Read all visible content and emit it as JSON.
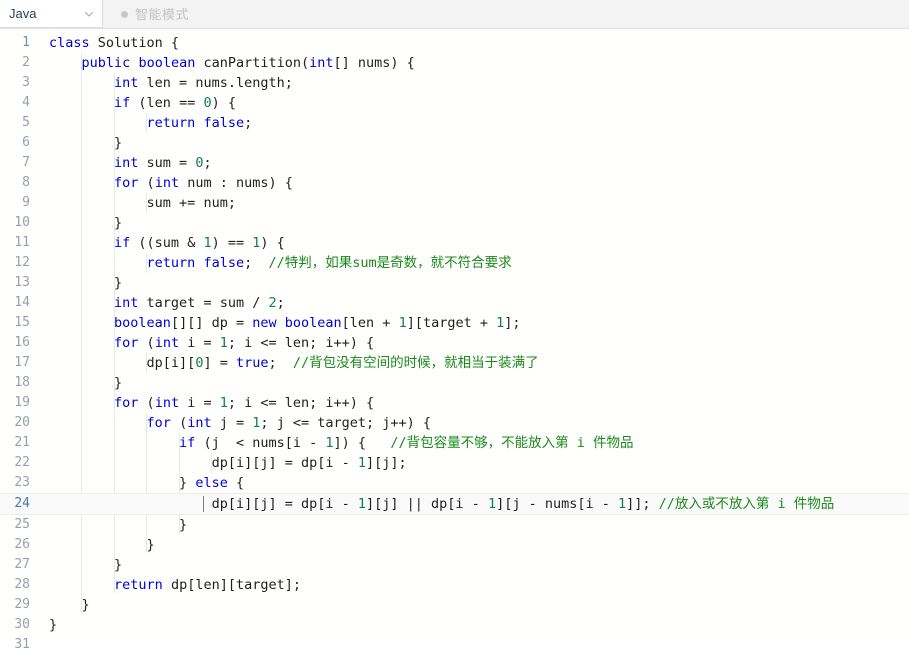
{
  "toolbar": {
    "language": "Java",
    "chevron_icon": "chevron-down-icon",
    "mode_dot_icon": "status-dot-icon",
    "mode_label": "智能模式"
  },
  "editor": {
    "active_line": 24,
    "total_visible_lines": 31,
    "colors": {
      "keyword": "#0000d4",
      "number": "#0d8050",
      "comment": "#1a8a1a",
      "plain": "#1f1f1f",
      "line_number": "#93a1ad",
      "active_line_bg": "#fafafa",
      "toolbar_bg": "#f3f3f3"
    },
    "lines": [
      {
        "n": 1,
        "indent": 0,
        "tokens": [
          {
            "t": "kw",
            "v": "class"
          },
          {
            "t": "pl",
            "v": " Solution {"
          }
        ]
      },
      {
        "n": 2,
        "indent": 1,
        "tokens": [
          {
            "t": "kw",
            "v": "public"
          },
          {
            "t": "pl",
            "v": " "
          },
          {
            "t": "kw",
            "v": "boolean"
          },
          {
            "t": "pl",
            "v": " canPartition("
          },
          {
            "t": "kw",
            "v": "int"
          },
          {
            "t": "pl",
            "v": "[] nums) {"
          }
        ]
      },
      {
        "n": 3,
        "indent": 2,
        "tokens": [
          {
            "t": "kw",
            "v": "int"
          },
          {
            "t": "pl",
            "v": " len = nums.length;"
          }
        ]
      },
      {
        "n": 4,
        "indent": 2,
        "tokens": [
          {
            "t": "kw",
            "v": "if"
          },
          {
            "t": "pl",
            "v": " (len == "
          },
          {
            "t": "num",
            "v": "0"
          },
          {
            "t": "pl",
            "v": ") {"
          }
        ]
      },
      {
        "n": 5,
        "indent": 3,
        "tokens": [
          {
            "t": "kw",
            "v": "return"
          },
          {
            "t": "pl",
            "v": " "
          },
          {
            "t": "kw",
            "v": "false"
          },
          {
            "t": "pl",
            "v": ";"
          }
        ]
      },
      {
        "n": 6,
        "indent": 2,
        "tokens": [
          {
            "t": "pl",
            "v": "}"
          }
        ]
      },
      {
        "n": 7,
        "indent": 2,
        "tokens": [
          {
            "t": "kw",
            "v": "int"
          },
          {
            "t": "pl",
            "v": " sum = "
          },
          {
            "t": "num",
            "v": "0"
          },
          {
            "t": "pl",
            "v": ";"
          }
        ]
      },
      {
        "n": 8,
        "indent": 2,
        "tokens": [
          {
            "t": "kw",
            "v": "for"
          },
          {
            "t": "pl",
            "v": " ("
          },
          {
            "t": "kw",
            "v": "int"
          },
          {
            "t": "pl",
            "v": " num : nums) {"
          }
        ]
      },
      {
        "n": 9,
        "indent": 3,
        "tokens": [
          {
            "t": "pl",
            "v": "sum += num;"
          }
        ]
      },
      {
        "n": 10,
        "indent": 2,
        "tokens": [
          {
            "t": "pl",
            "v": "}"
          }
        ]
      },
      {
        "n": 11,
        "indent": 2,
        "tokens": [
          {
            "t": "kw",
            "v": "if"
          },
          {
            "t": "pl",
            "v": " ((sum & "
          },
          {
            "t": "num",
            "v": "1"
          },
          {
            "t": "pl",
            "v": ") == "
          },
          {
            "t": "num",
            "v": "1"
          },
          {
            "t": "pl",
            "v": ") {"
          }
        ]
      },
      {
        "n": 12,
        "indent": 3,
        "tokens": [
          {
            "t": "kw",
            "v": "return"
          },
          {
            "t": "pl",
            "v": " "
          },
          {
            "t": "kw",
            "v": "false"
          },
          {
            "t": "pl",
            "v": ";  "
          },
          {
            "t": "cmt",
            "v": "//特判，如果sum是奇数，就不符合要求"
          }
        ]
      },
      {
        "n": 13,
        "indent": 2,
        "tokens": [
          {
            "t": "pl",
            "v": "}"
          }
        ]
      },
      {
        "n": 14,
        "indent": 2,
        "tokens": [
          {
            "t": "kw",
            "v": "int"
          },
          {
            "t": "pl",
            "v": " target = sum / "
          },
          {
            "t": "num",
            "v": "2"
          },
          {
            "t": "pl",
            "v": ";"
          }
        ]
      },
      {
        "n": 15,
        "indent": 2,
        "tokens": [
          {
            "t": "kw",
            "v": "boolean"
          },
          {
            "t": "pl",
            "v": "[][] dp = "
          },
          {
            "t": "kw",
            "v": "new"
          },
          {
            "t": "pl",
            "v": " "
          },
          {
            "t": "kw",
            "v": "boolean"
          },
          {
            "t": "pl",
            "v": "[len + "
          },
          {
            "t": "num",
            "v": "1"
          },
          {
            "t": "pl",
            "v": "][target + "
          },
          {
            "t": "num",
            "v": "1"
          },
          {
            "t": "pl",
            "v": "];"
          }
        ]
      },
      {
        "n": 16,
        "indent": 2,
        "tokens": [
          {
            "t": "kw",
            "v": "for"
          },
          {
            "t": "pl",
            "v": " ("
          },
          {
            "t": "kw",
            "v": "int"
          },
          {
            "t": "pl",
            "v": " i = "
          },
          {
            "t": "num",
            "v": "1"
          },
          {
            "t": "pl",
            "v": "; i <= len; i++) {"
          }
        ]
      },
      {
        "n": 17,
        "indent": 3,
        "tokens": [
          {
            "t": "pl",
            "v": "dp[i]["
          },
          {
            "t": "num",
            "v": "0"
          },
          {
            "t": "pl",
            "v": "] = "
          },
          {
            "t": "kw",
            "v": "true"
          },
          {
            "t": "pl",
            "v": ";  "
          },
          {
            "t": "cmt",
            "v": "//背包没有空间的时候，就相当于装满了"
          }
        ]
      },
      {
        "n": 18,
        "indent": 2,
        "tokens": [
          {
            "t": "pl",
            "v": "}"
          }
        ]
      },
      {
        "n": 19,
        "indent": 2,
        "tokens": [
          {
            "t": "kw",
            "v": "for"
          },
          {
            "t": "pl",
            "v": " ("
          },
          {
            "t": "kw",
            "v": "int"
          },
          {
            "t": "pl",
            "v": " i = "
          },
          {
            "t": "num",
            "v": "1"
          },
          {
            "t": "pl",
            "v": "; i <= len; i++) {"
          }
        ]
      },
      {
        "n": 20,
        "indent": 3,
        "tokens": [
          {
            "t": "kw",
            "v": "for"
          },
          {
            "t": "pl",
            "v": " ("
          },
          {
            "t": "kw",
            "v": "int"
          },
          {
            "t": "pl",
            "v": " j = "
          },
          {
            "t": "num",
            "v": "1"
          },
          {
            "t": "pl",
            "v": "; j <= target; j++) {"
          }
        ]
      },
      {
        "n": 21,
        "indent": 4,
        "tokens": [
          {
            "t": "kw",
            "v": "if"
          },
          {
            "t": "pl",
            "v": " (j  < nums[i - "
          },
          {
            "t": "num",
            "v": "1"
          },
          {
            "t": "pl",
            "v": "]) {   "
          },
          {
            "t": "cmt",
            "v": "//背包容量不够，不能放入第 i 件物品"
          }
        ]
      },
      {
        "n": 22,
        "indent": 5,
        "tokens": [
          {
            "t": "pl",
            "v": "dp[i][j] = dp[i - "
          },
          {
            "t": "num",
            "v": "1"
          },
          {
            "t": "pl",
            "v": "][j];"
          }
        ]
      },
      {
        "n": 23,
        "indent": 4,
        "tokens": [
          {
            "t": "pl",
            "v": "} "
          },
          {
            "t": "kw",
            "v": "else"
          },
          {
            "t": "pl",
            "v": " {"
          }
        ]
      },
      {
        "n": 24,
        "indent": 5,
        "tokens": [
          {
            "t": "pl",
            "v": "dp[i][j] = dp[i - "
          },
          {
            "t": "num",
            "v": "1"
          },
          {
            "t": "pl",
            "v": "][j] || dp[i - "
          },
          {
            "t": "num",
            "v": "1"
          },
          {
            "t": "pl",
            "v": "][j - nums[i - "
          },
          {
            "t": "num",
            "v": "1"
          },
          {
            "t": "pl",
            "v": "]]; "
          },
          {
            "t": "cmt",
            "v": "//放入或不放入第 i 件物品"
          }
        ]
      },
      {
        "n": 25,
        "indent": 4,
        "tokens": [
          {
            "t": "pl",
            "v": "}"
          }
        ]
      },
      {
        "n": 26,
        "indent": 3,
        "tokens": [
          {
            "t": "pl",
            "v": "}"
          }
        ]
      },
      {
        "n": 27,
        "indent": 2,
        "tokens": [
          {
            "t": "pl",
            "v": "}"
          }
        ]
      },
      {
        "n": 28,
        "indent": 2,
        "tokens": [
          {
            "t": "kw",
            "v": "return"
          },
          {
            "t": "pl",
            "v": " dp[len][target];"
          }
        ]
      },
      {
        "n": 29,
        "indent": 1,
        "tokens": [
          {
            "t": "pl",
            "v": "}"
          }
        ]
      },
      {
        "n": 30,
        "indent": 0,
        "tokens": [
          {
            "t": "pl",
            "v": "}"
          }
        ]
      },
      {
        "n": 31,
        "indent": 0,
        "tokens": []
      }
    ]
  }
}
